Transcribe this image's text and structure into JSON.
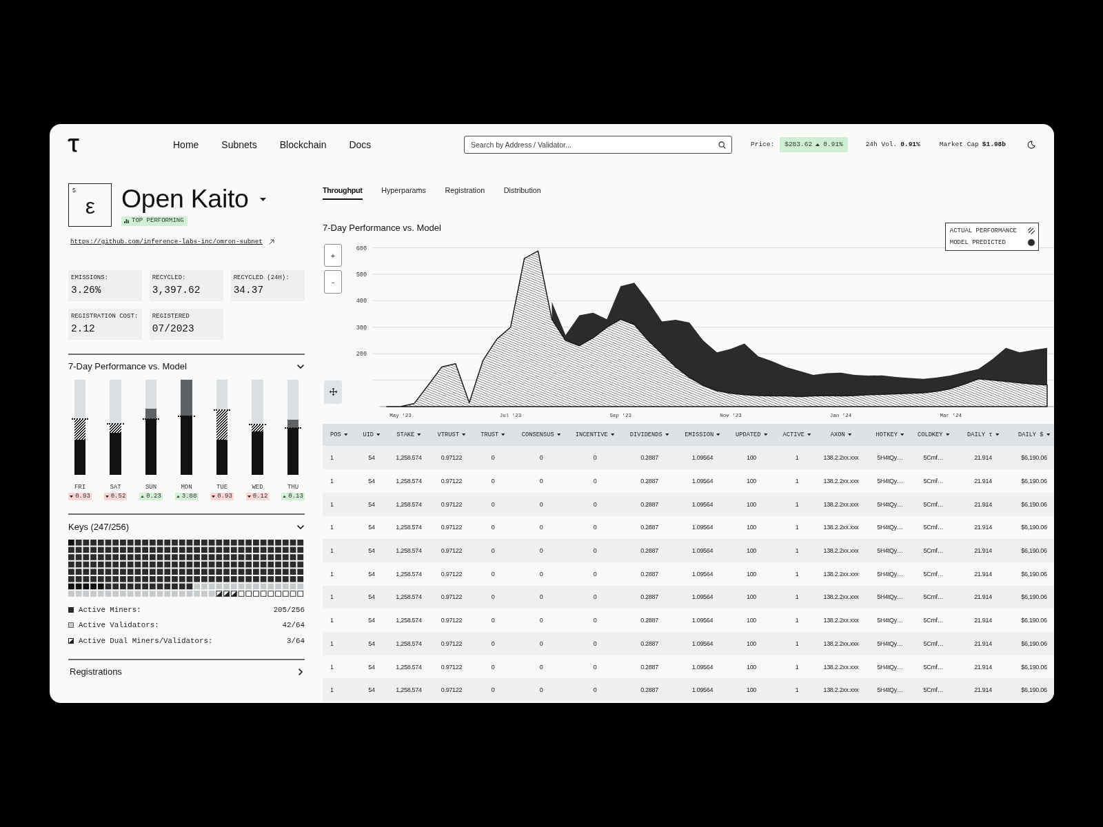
{
  "nav": {
    "links": [
      "Home",
      "Subnets",
      "Blockchain",
      "Docs"
    ]
  },
  "search": {
    "placeholder": "Search by Address / Validator..."
  },
  "market": {
    "price_label": "Price:",
    "price": "$283.62",
    "price_up": true,
    "price_change": "0.91%",
    "volume_label": "24h Vol.",
    "volume": "0.91%",
    "market_cap_label": "Market Cap",
    "market_cap": "$1.98b"
  },
  "subnet": {
    "number": "5",
    "symbol": "ε",
    "name": "Open Kaito",
    "badge": "TOP PERFORMING",
    "url": "https://github.com/inference-labs-inc/omron-subnet"
  },
  "stats": [
    {
      "label": "EMISSIONS:",
      "value": "3.26%"
    },
    {
      "label": "RECYCLED:",
      "value": "3,397.62"
    },
    {
      "label": "RECYCLED (24H):",
      "value": "34.37"
    },
    {
      "label": "REGISTRATION COST:",
      "value": "2.12"
    },
    {
      "label": "REGISTERED",
      "value": "07/2023"
    }
  ],
  "performance": {
    "title": "7-Day Performance vs. Model",
    "expanded": true,
    "days": [
      {
        "label": "FRI",
        "level": 0.37,
        "model": {
          "level": 0.59
        },
        "increase": false,
        "delta": "0.93"
      },
      {
        "label": "SAT",
        "level": 0.44,
        "model": {
          "level": 0.54
        },
        "increase": false,
        "delta": "0.52"
      },
      {
        "label": "SUN",
        "level": 0.7,
        "model": {
          "level": 0.59
        },
        "increase": true,
        "delta": "0.23"
      },
      {
        "label": "MON",
        "level": 1.0,
        "model": {
          "level": 0.62
        },
        "increase": true,
        "delta": "3.88"
      },
      {
        "label": "TUE",
        "level": 0.37,
        "model": {
          "level": 0.68
        },
        "increase": false,
        "delta": "0.93"
      },
      {
        "label": "WED",
        "level": 0.46,
        "model": {
          "level": 0.53
        },
        "increase": false,
        "delta": "0.12"
      },
      {
        "label": "THU",
        "level": 0.58,
        "model": {
          "level": 0.49
        },
        "increase": true,
        "delta": "0.13"
      }
    ]
  },
  "keys": {
    "title": "Keys (247/256)",
    "expanded": true,
    "legend": [
      {
        "kind": "miner",
        "label": "Active Miners:",
        "value": "205/256"
      },
      {
        "kind": "validator",
        "label": "Active Validators:",
        "value": "42/64"
      },
      {
        "kind": "dual",
        "label": "Active Dual Miners/Validators:",
        "value": "3/64"
      }
    ]
  },
  "registrations": {
    "title": "Registrations",
    "expanded": false
  },
  "tabs": [
    {
      "label": "Throughput",
      "selected": true
    },
    {
      "label": "Hyperparams",
      "selected": false
    },
    {
      "label": "Registration",
      "selected": false
    },
    {
      "label": "Distribution",
      "selected": false
    }
  ],
  "chart": {
    "zoom_buttons": [
      "+",
      "-"
    ],
    "chart_data": {
      "type": "area",
      "title": "7-Day Performance vs. Model",
      "categories": [
        null,
        "May ’23",
        null,
        null,
        null,
        null,
        null,
        null,
        null,
        "Jul ’23",
        null,
        null,
        null,
        null,
        null,
        null,
        null,
        "Sep ’23",
        null,
        null,
        null,
        null,
        null,
        null,
        null,
        "Nov ’23",
        null,
        null,
        null,
        null,
        null,
        null,
        null,
        "Jan ’24",
        null,
        null,
        null,
        null,
        null,
        null,
        null,
        "Mar ’24",
        null,
        null,
        null,
        null,
        null,
        null,
        null
      ],
      "series": [
        {
          "name": "ACTUAL PERFORMANCE",
          "color": "#1a1a1a",
          "values": [
            0,
            0,
            12,
            80,
            150,
            162,
            15,
            175,
            255,
            300,
            560,
            588,
            330,
            250,
            230,
            260,
            300,
            330,
            310,
            250,
            200,
            150,
            110,
            80,
            60,
            50,
            45,
            42,
            40,
            40,
            38,
            40,
            42,
            40,
            42,
            45,
            46,
            48,
            50,
            52,
            58,
            68,
            85,
            105,
            100,
            95,
            90,
            85,
            82
          ]
        },
        {
          "name": "MODEL PREDICTED",
          "color": "#2b2b2b",
          "values": [
            null,
            null,
            null,
            null,
            null,
            null,
            null,
            null,
            null,
            null,
            null,
            null,
            395,
            270,
            345,
            355,
            330,
            455,
            468,
            400,
            322,
            328,
            318,
            250,
            205,
            218,
            238,
            190,
            172,
            150,
            135,
            120,
            126,
            128,
            120,
            117,
            118,
            112,
            108,
            105,
            110,
            118,
            130,
            142,
            178,
            222,
            205,
            214,
            222
          ]
        }
      ],
      "ylim": [
        0,
        600
      ],
      "yticks": [
        200,
        300,
        400,
        500,
        600
      ],
      "grid": true
    }
  },
  "table": {
    "columns": [
      "POS",
      "UID",
      "STAKE",
      "VTRUST",
      "TRUST",
      "CONSENSUS",
      "INCENTIVE",
      "DIVIDENDS",
      "EMISSION",
      "UPDATED",
      "ACTIVE",
      "AXON",
      "HOTKEY",
      "COLDKEY",
      "DAILY τ",
      "DAILY $"
    ],
    "rows": [
      [
        "1",
        "54",
        "1,258.574",
        "0.97122",
        "0",
        "0",
        "0",
        "0.2887",
        "1.09564",
        "100",
        "1",
        "138.2.2xx.xxx",
        "5H4tQy…",
        "5Cmf…",
        "21.914",
        "$6,190.06"
      ],
      [
        "1",
        "54",
        "1,258.574",
        "0.97122",
        "0",
        "0",
        "0",
        "0.2887",
        "1.09564",
        "100",
        "1",
        "138.2.2xx.xxx",
        "5H4tQy…",
        "5Cmf…",
        "21.914",
        "$6,190.06"
      ],
      [
        "1",
        "54",
        "1,258.574",
        "0.97122",
        "0",
        "0",
        "0",
        "0.2887",
        "1.09564",
        "100",
        "1",
        "138.2.2xx.xxx",
        "5H4tQy…",
        "5Cmf…",
        "21.914",
        "$6,190.06"
      ],
      [
        "1",
        "54",
        "1,258.574",
        "0.97122",
        "0",
        "0",
        "0",
        "0.2887",
        "1.09564",
        "100",
        "1",
        "138.2.2xx.xxx",
        "5H4tQy…",
        "5Cmf…",
        "21.914",
        "$6,190.06"
      ],
      [
        "1",
        "54",
        "1,258.574",
        "0.97122",
        "0",
        "0",
        "0",
        "0.2887",
        "1.09564",
        "100",
        "1",
        "138.2.2xx.xxx",
        "5H4tQy…",
        "5Cmf…",
        "21.914",
        "$6,190.06"
      ],
      [
        "1",
        "54",
        "1,258.574",
        "0.97122",
        "0",
        "0",
        "0",
        "0.2887",
        "1.09564",
        "100",
        "1",
        "138.2.2xx.xxx",
        "5H4tQy…",
        "5Cmf…",
        "21.914",
        "$6,190.06"
      ],
      [
        "1",
        "54",
        "1,258.574",
        "0.97122",
        "0",
        "0",
        "0",
        "0.2887",
        "1.09564",
        "100",
        "1",
        "138.2.2xx.xxx",
        "5H4tQy…",
        "5Cmf…",
        "21.914",
        "$6,190.06"
      ],
      [
        "1",
        "54",
        "1,258.574",
        "0.97122",
        "0",
        "0",
        "0",
        "0.2887",
        "1.09564",
        "100",
        "1",
        "138.2.2xx.xxx",
        "5H4tQy…",
        "5Cmf…",
        "21.914",
        "$6,190.06"
      ],
      [
        "1",
        "54",
        "1,258.574",
        "0.97122",
        "0",
        "0",
        "0",
        "0.2887",
        "1.09564",
        "100",
        "1",
        "138.2.2xx.xxx",
        "5H4tQy…",
        "5Cmf…",
        "21.914",
        "$6,190.06"
      ],
      [
        "1",
        "54",
        "1,258.574",
        "0.97122",
        "0",
        "0",
        "0",
        "0.2887",
        "1.09564",
        "100",
        "1",
        "138.2.2xx.xxx",
        "5H4tQy…",
        "5Cmf…",
        "21.914",
        "$6,190.06"
      ],
      [
        "1",
        "54",
        "1,258.574",
        "0.97122",
        "0",
        "0",
        "0",
        "0.2887",
        "1.09564",
        "100",
        "1",
        "138.2.2xx.xxx",
        "5H4tQy…",
        "5Cmf…",
        "21.914",
        "$6,190.06"
      ]
    ]
  }
}
